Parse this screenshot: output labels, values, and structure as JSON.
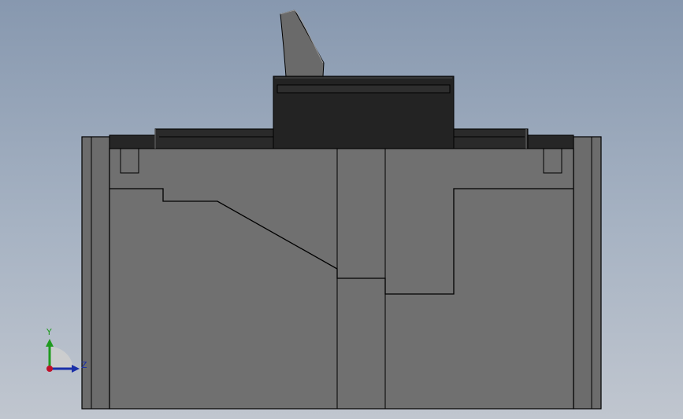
{
  "viewport": {
    "background_top": "#8798af",
    "background_bottom": "#c0c6cf"
  },
  "model": {
    "view": "side-view",
    "body_color": "#707070",
    "cap_color": "#262626",
    "handle_color": "#6a6a6a",
    "edge_color": "#000000"
  },
  "triad": {
    "y_label": "Y",
    "z_label": "Z",
    "y_color": "#1f9a1f",
    "z_color": "#1a2fa8",
    "x_color": "#c0102a"
  }
}
